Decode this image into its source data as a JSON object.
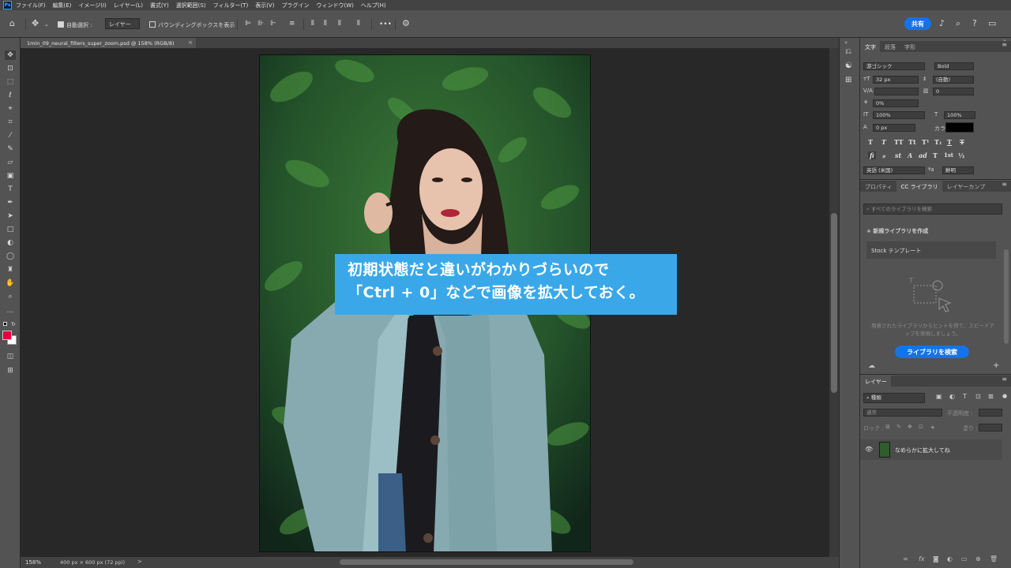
{
  "menubar": {
    "logo": "Ps",
    "items": [
      "ファイル(F)",
      "編集(E)",
      "イメージ(I)",
      "レイヤー(L)",
      "書式(Y)",
      "選択範囲(S)",
      "フィルター(T)",
      "表示(V)",
      "プラグイン",
      "ウィンドウ(W)",
      "ヘルプ(H)"
    ]
  },
  "options": {
    "auto_select_label": "自動選択 :",
    "layer_select": "レイヤー",
    "bbox_label": "バウンディングボックスを表示",
    "more": "•••",
    "share_label": "共有"
  },
  "document": {
    "tab_title": "1min_09_neural_filters_super_zoom.psd @ 158% (RGB/8)",
    "close": "×"
  },
  "caption": {
    "line1": "初期状態だと違いがわかりづらいので",
    "line2": "「Ctrl + 0」などで画像を拡大しておく。"
  },
  "status": {
    "zoom": "158%",
    "doc_size": "400 px × 600 px (72 ppi)",
    "arrow": ">"
  },
  "char_panel": {
    "tabs": [
      "文字",
      "段落",
      "字形"
    ],
    "font_family": "游ゴシック",
    "font_style": "Bold",
    "font_size": "32 px",
    "leading": "(自動)",
    "tracking": "0",
    "tsume": "0%",
    "vscale": "100%",
    "hscale": "100%",
    "baseline": "0 px",
    "color_label": "カラー :",
    "text_color": "#000000",
    "glyphs": [
      "T",
      "T",
      "TT",
      "Tt",
      "T¹",
      "T₁",
      "T",
      "T"
    ],
    "glyphs2": [
      "fi",
      "ℴ",
      "st",
      "A",
      "ad",
      "T",
      "1st",
      "½"
    ],
    "language": "英語 (米国)",
    "aa": "鮮明"
  },
  "lib_panel": {
    "tabs": [
      "プロパティ",
      "CC ライブラリ",
      "レイヤーカンプ"
    ],
    "search_placeholder": "すべてのライブラリを検索",
    "new_library": "新規ライブラリを作成",
    "stock_template": "Stock テンプレート",
    "description": "用意されたライブラリからヒントを得て、スピードアップを実現しましょう。",
    "search_button": "ライブラリを検索"
  },
  "layers_panel": {
    "tab": "レイヤー",
    "kind": "種類",
    "blend_mode": "通常",
    "opacity_label": "不透明度 :",
    "lock_label": "ロック :",
    "fill_label": "塗り :",
    "layer_name": "なめらかに拡大してね"
  },
  "colors": {
    "accent": "#1473e6",
    "caption_bg": "#3aa8e8",
    "foreground": "#e0003c",
    "background": "#ffffff"
  }
}
